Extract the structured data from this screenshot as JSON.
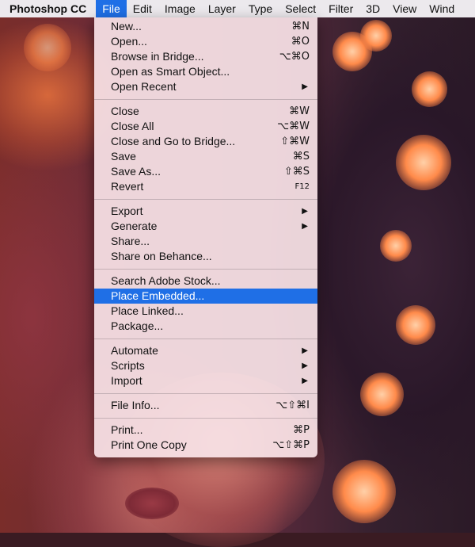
{
  "menubar": {
    "app": "Photoshop CC",
    "items": [
      {
        "label": "File"
      },
      {
        "label": "Edit"
      },
      {
        "label": "Image"
      },
      {
        "label": "Layer"
      },
      {
        "label": "Type"
      },
      {
        "label": "Select"
      },
      {
        "label": "Filter"
      },
      {
        "label": "3D"
      },
      {
        "label": "View"
      },
      {
        "label": "Wind"
      }
    ]
  },
  "file_menu": {
    "groups": [
      [
        {
          "label": "New...",
          "shortcut": "⌘N"
        },
        {
          "label": "Open...",
          "shortcut": "⌘O"
        },
        {
          "label": "Browse in Bridge...",
          "shortcut": "⌥⌘O"
        },
        {
          "label": "Open as Smart Object...",
          "shortcut": ""
        },
        {
          "label": "Open Recent",
          "shortcut": "",
          "submenu": true
        }
      ],
      [
        {
          "label": "Close",
          "shortcut": "⌘W"
        },
        {
          "label": "Close All",
          "shortcut": "⌥⌘W"
        },
        {
          "label": "Close and Go to Bridge...",
          "shortcut": "⇧⌘W"
        },
        {
          "label": "Save",
          "shortcut": "⌘S"
        },
        {
          "label": "Save As...",
          "shortcut": "⇧⌘S"
        },
        {
          "label": "Revert",
          "shortcut": "F12"
        }
      ],
      [
        {
          "label": "Export",
          "shortcut": "",
          "submenu": true
        },
        {
          "label": "Generate",
          "shortcut": "",
          "submenu": true
        },
        {
          "label": "Share...",
          "shortcut": ""
        },
        {
          "label": "Share on Behance...",
          "shortcut": ""
        }
      ],
      [
        {
          "label": "Search Adobe Stock...",
          "shortcut": ""
        },
        {
          "label": "Place Embedded...",
          "shortcut": "",
          "highlighted": true
        },
        {
          "label": "Place Linked...",
          "shortcut": ""
        },
        {
          "label": "Package...",
          "shortcut": ""
        }
      ],
      [
        {
          "label": "Automate",
          "shortcut": "",
          "submenu": true
        },
        {
          "label": "Scripts",
          "shortcut": "",
          "submenu": true
        },
        {
          "label": "Import",
          "shortcut": "",
          "submenu": true
        }
      ],
      [
        {
          "label": "File Info...",
          "shortcut": "⌥⇧⌘I"
        }
      ],
      [
        {
          "label": "Print...",
          "shortcut": "⌘P"
        },
        {
          "label": "Print One Copy",
          "shortcut": "⌥⇧⌘P"
        }
      ]
    ],
    "submenu_icon": "▶"
  },
  "colors": {
    "menubar_bg": "#ece9ed",
    "highlight": "#1f6fe6",
    "menu_bg": "#f7e2e6"
  }
}
